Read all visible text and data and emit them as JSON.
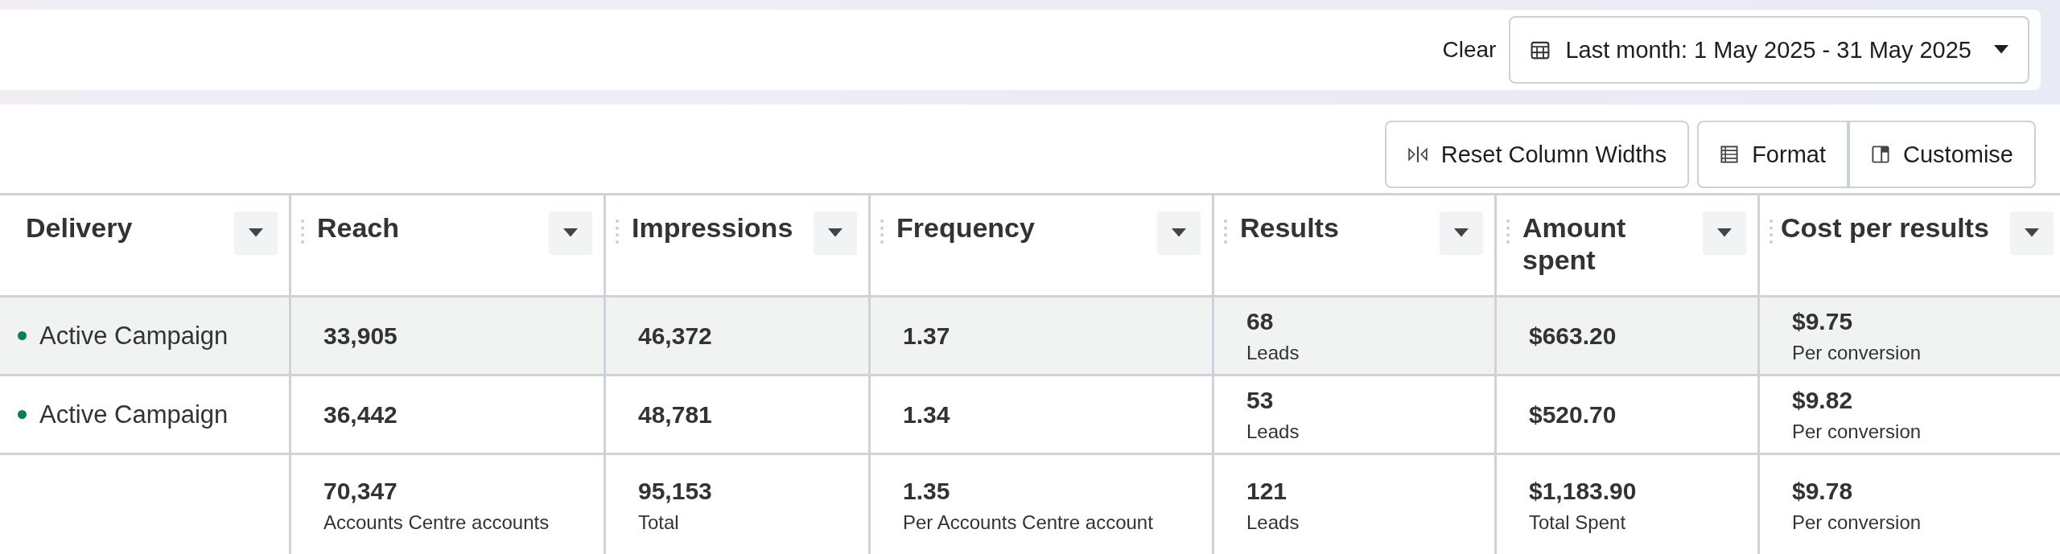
{
  "filter_bar": {
    "clear_label": "Clear",
    "date_range": "Last month: 1 May 2025 - 31 May 2025"
  },
  "toolbar": {
    "buttons": [
      {
        "label": "Reset Column Widths",
        "kind": "reset"
      },
      {
        "label": "Format",
        "kind": "format"
      },
      {
        "label": "Customise",
        "kind": "customise"
      }
    ]
  },
  "table": {
    "columns": [
      "Delivery",
      "Reach",
      "Impressions",
      "Frequency",
      "Results",
      "Amount spent",
      "Cost per results"
    ],
    "rows": [
      {
        "selected": true,
        "cells": [
          {
            "value": "Active Campaign",
            "color": "#0a7d5a"
          },
          {
            "value": "33,905"
          },
          {
            "value": "46,372"
          },
          {
            "value": "1.37"
          },
          {
            "value": "68",
            "sub": "Leads"
          },
          {
            "value": "$663.20"
          },
          {
            "value": "$9.75",
            "sub": "Per conversion"
          }
        ]
      },
      {
        "selected": false,
        "cells": [
          {
            "value": "Active Campaign",
            "color": "#0a7d5a"
          },
          {
            "value": "36,442"
          },
          {
            "value": "48,781"
          },
          {
            "value": "1.34"
          },
          {
            "value": "53",
            "sub": "Leads"
          },
          {
            "value": "$520.70"
          },
          {
            "value": "$9.82",
            "sub": "Per conversion"
          }
        ]
      }
    ],
    "totals": [
      {
        "value": "70,347",
        "sub": "Accounts Centre accounts"
      },
      {
        "value": "95,153",
        "sub": "Total"
      },
      {
        "value": "1.35",
        "sub": "Per Accounts Centre account"
      },
      {
        "value": "121",
        "sub": "Leads"
      },
      {
        "value": "$1,183.90",
        "sub": "Total Spent"
      },
      {
        "value": "$9.78",
        "sub": "Per conversion"
      }
    ]
  }
}
